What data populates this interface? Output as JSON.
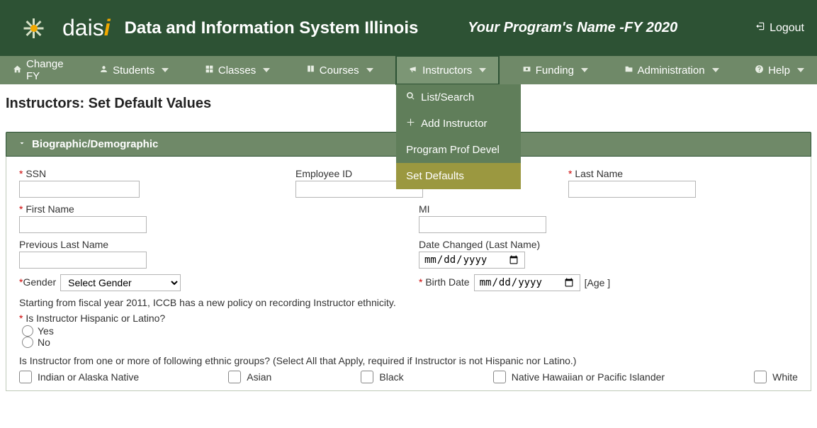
{
  "header": {
    "logo_text_main": "dais",
    "logo_text_accent": "i",
    "app_title": "Data and Information System Illinois",
    "program": "Your Program's Name -FY 2020",
    "logout": "Logout"
  },
  "nav": {
    "change_fy": "Change FY",
    "students": "Students",
    "classes": "Classes",
    "courses": "Courses",
    "instructors": "Instructors",
    "funding": "Funding",
    "administration": "Administration",
    "help": "Help"
  },
  "dropdown": {
    "list_search": "List/Search",
    "add_instructor": "Add Instructor",
    "prof_devel": "Program Prof Devel",
    "set_defaults": "Set Defaults"
  },
  "page": {
    "title": "Instructors: Set Default Values"
  },
  "panel": {
    "heading": "Biographic/Demographic"
  },
  "fields": {
    "ssn": "SSN",
    "employee_id": "Employee ID",
    "last_name": "Last Name",
    "first_name": "First Name",
    "mi": "MI",
    "prev_last_name": "Previous Last Name",
    "date_changed": "Date Changed (Last Name)",
    "date_changed_ph": "mm/dd/yyyy",
    "gender": "Gender",
    "gender_placeholder": "Select Gender",
    "birth_date": "Birth Date",
    "birth_date_ph": "mm/dd/yyyy",
    "age_suffix": "[Age ]"
  },
  "notes": {
    "ethnicity_policy": "Starting from fiscal year 2011, ICCB has a new policy on recording Instructor ethnicity.",
    "hispanic_q": "Is Instructor Hispanic or Latino?",
    "yes": "Yes",
    "no": "No",
    "ethnic_groups_q": "Is Instructor from one or more of following ethnic groups? (Select All that Apply, required if Instructor is not Hispanic nor Latino.)"
  },
  "ethnic": {
    "indian": "Indian or Alaska Native",
    "asian": "Asian",
    "black": "Black",
    "hawaiian": "Native Hawaiian or Pacific Islander",
    "white": "White"
  },
  "star": "*"
}
